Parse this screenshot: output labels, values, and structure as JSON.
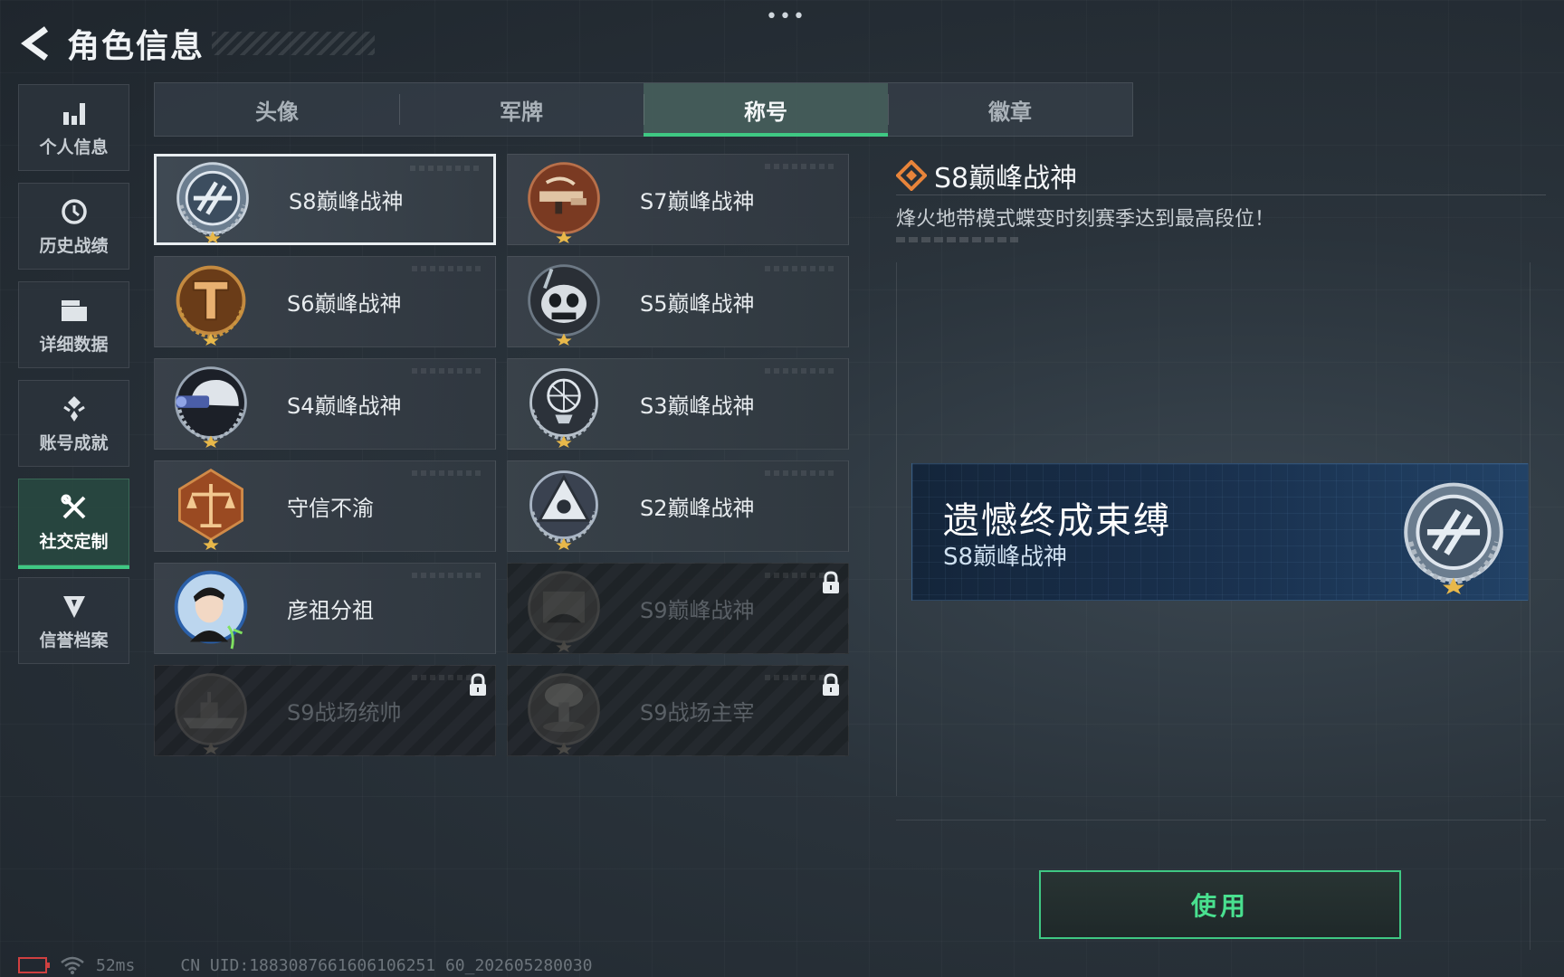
{
  "top": {
    "more": "•••"
  },
  "header": {
    "title": "角色信息"
  },
  "sidebar": {
    "items": [
      {
        "label": "个人信息",
        "icon": "bar-chart-icon",
        "active": false
      },
      {
        "label": "历史战绩",
        "icon": "history-icon",
        "active": false
      },
      {
        "label": "详细数据",
        "icon": "folder-icon",
        "active": false
      },
      {
        "label": "账号成就",
        "icon": "achievement-icon",
        "active": false
      },
      {
        "label": "社交定制",
        "icon": "tools-icon",
        "active": true
      },
      {
        "label": "信誉档案",
        "icon": "shield-icon",
        "active": false
      }
    ]
  },
  "tabs": [
    {
      "label": "头像",
      "active": false
    },
    {
      "label": "军牌",
      "active": false
    },
    {
      "label": "称号",
      "active": true
    },
    {
      "label": "徽章",
      "active": false
    }
  ],
  "titles": [
    {
      "name": "S8巅峰战神",
      "badge": "s8-badge",
      "state": "selected"
    },
    {
      "name": "S7巅峰战神",
      "badge": "s7-badge",
      "state": "normal"
    },
    {
      "name": "S6巅峰战神",
      "badge": "s6-badge",
      "state": "normal"
    },
    {
      "name": "S5巅峰战神",
      "badge": "s5-badge",
      "state": "normal"
    },
    {
      "name": "S4巅峰战神",
      "badge": "s4-badge",
      "state": "normal"
    },
    {
      "name": "S3巅峰战神",
      "badge": "s3-badge",
      "state": "normal"
    },
    {
      "name": "守信不渝",
      "badge": "scales-badge",
      "state": "normal"
    },
    {
      "name": "S2巅峰战神",
      "badge": "s2-badge",
      "state": "normal"
    },
    {
      "name": "彦祖分祖",
      "badge": "portrait-badge",
      "state": "normal"
    },
    {
      "name": "S9巅峰战神",
      "badge": "s9-badge",
      "state": "locked"
    },
    {
      "name": "S9战场统帅",
      "badge": "warship-badge",
      "state": "locked"
    },
    {
      "name": "S9战场主宰",
      "badge": "mushroom-cloud-badge",
      "state": "locked"
    }
  ],
  "detail": {
    "title": "S8巅峰战神",
    "description": "烽火地带模式蝶变时刻赛季达到最高段位！"
  },
  "preview": {
    "title": "遗憾终成束缚",
    "subtitle": "S8巅峰战神"
  },
  "actions": {
    "use_label": "使用"
  },
  "footer": {
    "ping": "52ms",
    "uid": "CN UID:1883087661606106251 60_202605280030"
  },
  "colors": {
    "accent": "#3fc883",
    "selected_border": "#e9eef1",
    "preview_bg": "#1a3250"
  }
}
